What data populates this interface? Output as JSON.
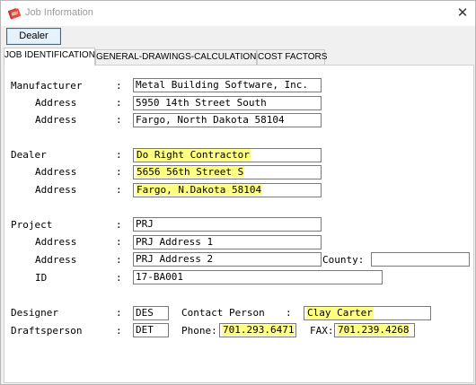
{
  "window": {
    "title": "Job Information",
    "close_glyph": "✕"
  },
  "toolbar": {
    "dealer_button": "Dealer"
  },
  "tabs": [
    "JOB IDENTIFICATION",
    "GENERAL-DRAWINGS-CALCULATIONS",
    "COST FACTORS"
  ],
  "colon": ":",
  "manufacturer": {
    "label": "Manufacturer",
    "address_label": "Address",
    "name": "Metal Building Software, Inc.",
    "address1": "5950 14th Street South",
    "address2": "Fargo, North Dakota 58104"
  },
  "dealer": {
    "label": "Dealer",
    "address_label": "Address",
    "name": "Do Right Contractor",
    "address1": "5656 56th Street S",
    "address2": "Fargo, N.Dakota 58104"
  },
  "project": {
    "label": "Project",
    "address_label": "Address",
    "id_label": "ID",
    "county_label": "County:",
    "name": "PRJ",
    "address1": "PRJ Address 1",
    "address2": "PRJ Address 2",
    "county": "",
    "id": "17-BA001"
  },
  "people": {
    "designer_label": "Designer",
    "draftsperson_label": "Draftsperson",
    "designer": "DES",
    "draftsperson": "DET",
    "contact_label": "Contact Person",
    "contact": "Clay Carter",
    "phone_label": "Phone:",
    "phone": "701.293.6471",
    "fax_label": "FAX:",
    "fax": "701.239.4268"
  },
  "colors": {
    "highlight": "#ffff80",
    "accent": "#0078d7"
  },
  "icons": {
    "app": "app-icon",
    "close": "close-icon"
  }
}
